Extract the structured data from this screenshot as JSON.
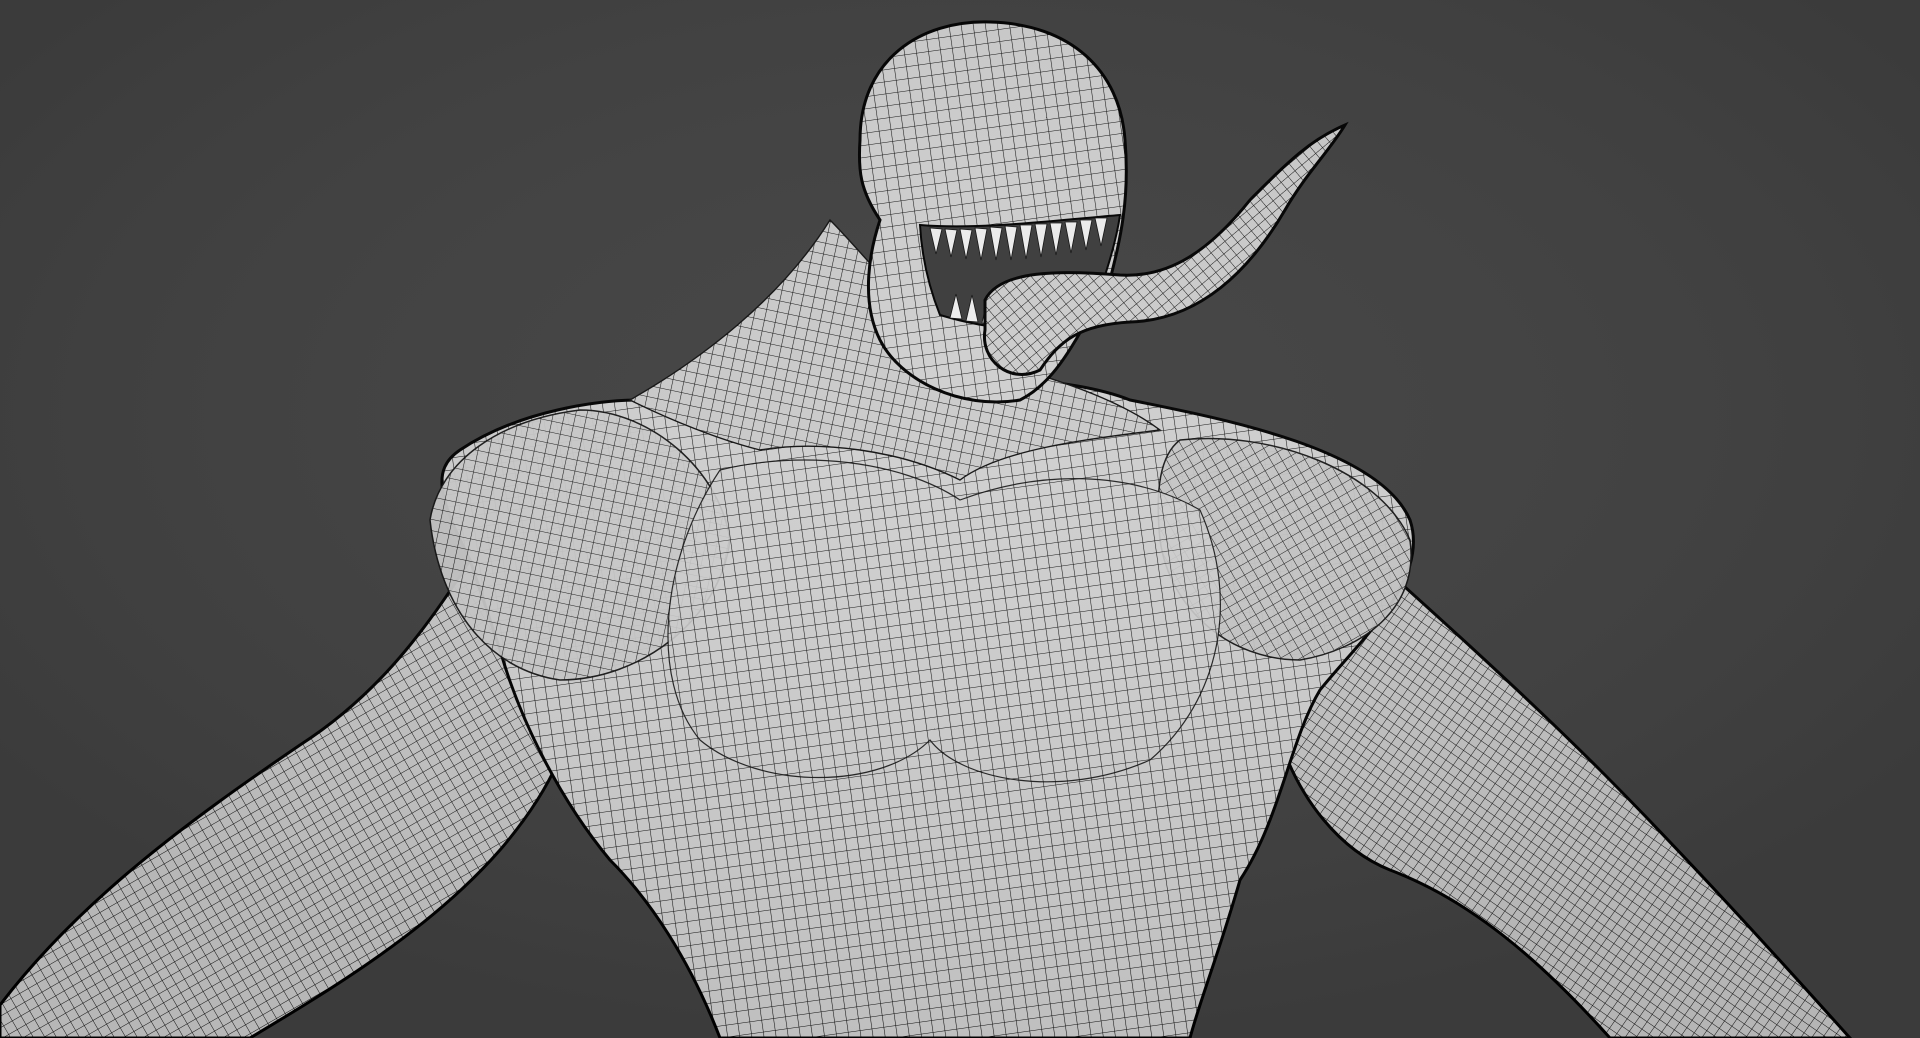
{
  "viewport": {
    "background_color": "#404040",
    "mesh_fill_color": "#cfcfcf",
    "wire_color": "#111111",
    "teeth_color": "#eeeeee",
    "shading": "wireframe-over-solid",
    "subject": "symbiote-creature-upper-body"
  }
}
